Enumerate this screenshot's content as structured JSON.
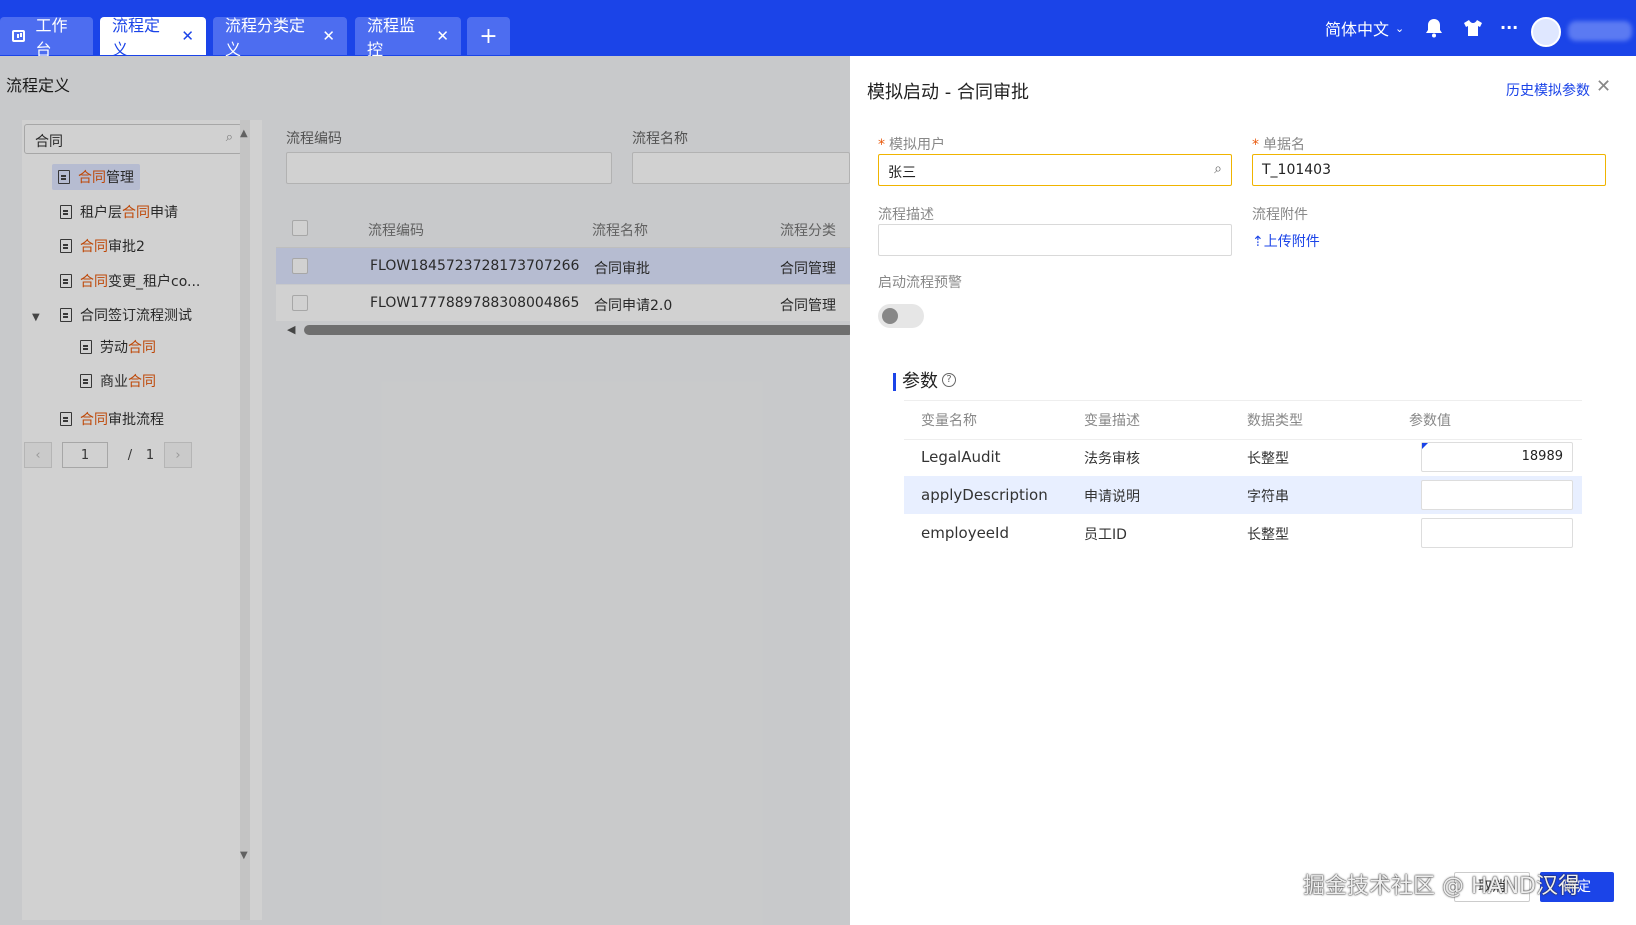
{
  "tabs": [
    {
      "label": "工作台"
    },
    {
      "label": "流程定义"
    },
    {
      "label": "流程分类定义"
    },
    {
      "label": "流程监控"
    }
  ],
  "add_tab": "+",
  "header": {
    "language": "简体中文",
    "more": "···"
  },
  "page": {
    "breadcrumb": "流程定义",
    "search_value": "合同",
    "tree": [
      {
        "hl_before": "",
        "highlight": "合同",
        "rest": "管理"
      },
      {
        "hl_before": "租户层",
        "highlight": "合同",
        "rest": "申请"
      },
      {
        "hl_before": "",
        "highlight": "合同",
        "rest": "审批2"
      },
      {
        "hl_before": "",
        "highlight": "合同",
        "rest": "变更_租户co..."
      },
      {
        "hl_before": "合同签订流程测试",
        "highlight": "",
        "rest": ""
      },
      {
        "hl_before": "劳动",
        "highlight": "合同",
        "rest": ""
      },
      {
        "hl_before": "商业",
        "highlight": "合同",
        "rest": ""
      },
      {
        "hl_before": "",
        "highlight": "合同",
        "rest": "审批流程"
      }
    ],
    "pager": {
      "current": "1",
      "separator": "/",
      "total": "1"
    },
    "filters": {
      "code_label": "流程编码",
      "name_label": "流程名称"
    },
    "table": {
      "headers": [
        "流程编码",
        "流程名称",
        "流程分类"
      ],
      "rows": [
        [
          "FLOW1845723728173707266",
          "合同审批",
          "合同管理"
        ],
        [
          "FLOW1777889788308004865",
          "合同申请2.0",
          "合同管理"
        ]
      ]
    }
  },
  "drawer": {
    "title": "模拟启动 - 合同审批",
    "history_link": "历史模拟参数",
    "user_label": "模拟用户",
    "user_value": "张三",
    "doc_label": "单据名",
    "doc_value": "T_101403",
    "desc_label": "流程描述",
    "attach_label": "流程附件",
    "upload_label": "上传附件",
    "warn_label": "启动流程预警",
    "warn_enabled": false,
    "params_title": "参数",
    "params_headers": [
      "变量名称",
      "变量描述",
      "数据类型",
      "参数值"
    ],
    "params": [
      {
        "name": "LegalAudit",
        "desc": "法务审核",
        "type": "长整型",
        "value": "18989"
      },
      {
        "name": "applyDescription",
        "desc": "申请说明",
        "type": "字符串",
        "value": ""
      },
      {
        "name": "employeeId",
        "desc": "员工ID",
        "type": "长整型",
        "value": ""
      }
    ],
    "cancel_label": "取消",
    "ok_label": "确定"
  },
  "watermark": "掘金技术社区 @ HAND汉得",
  "colors": {
    "primary": "#1b44e8",
    "highlight": "#e8590c",
    "focus_border": "#f0b400"
  }
}
